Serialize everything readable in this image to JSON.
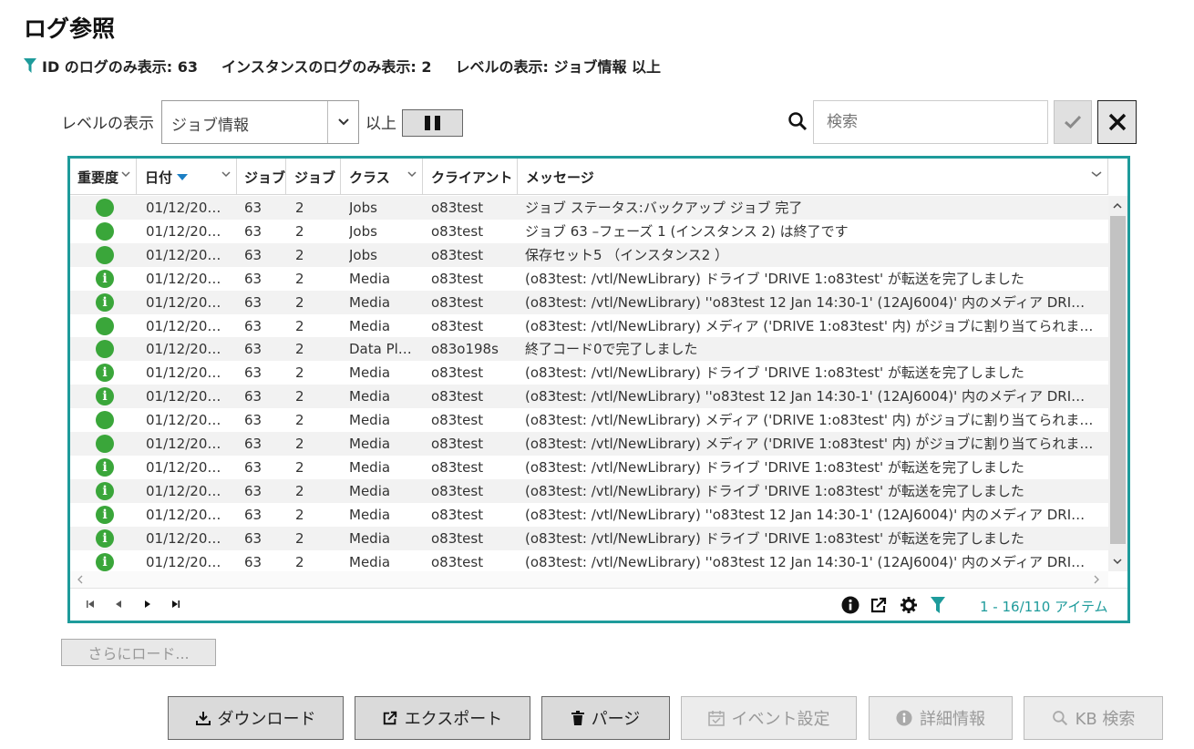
{
  "page": {
    "title": "ログ参照",
    "filter_summary": {
      "id_filter": "ID のログのみ表示: 63",
      "instance_filter": "インスタンスのログのみ表示: 2",
      "level_filter": "レベルの表示: ジョブ情報 以上"
    }
  },
  "toolbar": {
    "level_label": "レベルの表示",
    "level_value": "ジョブ情報",
    "above_label": "以上",
    "search_placeholder": "検索"
  },
  "table": {
    "columns": [
      "重要度",
      "日付",
      "ジョブ",
      "ジョブ",
      "クラス",
      "クライアント",
      "メッセージ"
    ],
    "rows": [
      {
        "sev": "ok",
        "date": "01/12/20…",
        "job": "63",
        "inst": "2",
        "class": "Jobs",
        "client": "o83test",
        "msg": "ジョブ ステータス:バックアップ ジョブ 完了"
      },
      {
        "sev": "ok",
        "date": "01/12/20…",
        "job": "63",
        "inst": "2",
        "class": "Jobs",
        "client": "o83test",
        "msg": "ジョブ 63 –フェーズ 1 (インスタンス 2) は終了です"
      },
      {
        "sev": "ok",
        "date": "01/12/20…",
        "job": "63",
        "inst": "2",
        "class": "Jobs",
        "client": "o83test",
        "msg": "保存セット5 （インスタンス2 ）"
      },
      {
        "sev": "info",
        "date": "01/12/20…",
        "job": "63",
        "inst": "2",
        "class": "Media",
        "client": "o83test",
        "msg": "(o83test: /vtl/NewLibrary) ドライブ 'DRIVE 1:o83test' が転送を完了しました"
      },
      {
        "sev": "info",
        "date": "01/12/20…",
        "job": "63",
        "inst": "2",
        "class": "Media",
        "client": "o83test",
        "msg": "(o83test: /vtl/NewLibrary) ''o83test 12 Jan 14:30-1' (12AJ6004)' 内のメディア DRI…"
      },
      {
        "sev": "ok",
        "date": "01/12/20…",
        "job": "63",
        "inst": "2",
        "class": "Media",
        "client": "o83test",
        "msg": "(o83test: /vtl/NewLibrary) メディア ('DRIVE 1:o83test' 内) がジョブに割り当てられま…"
      },
      {
        "sev": "ok",
        "date": "01/12/20…",
        "job": "63",
        "inst": "2",
        "class": "Data Pl…",
        "client": "o83o198s",
        "msg": "終了コード0で完了しました"
      },
      {
        "sev": "info",
        "date": "01/12/20…",
        "job": "63",
        "inst": "2",
        "class": "Media",
        "client": "o83test",
        "msg": "(o83test: /vtl/NewLibrary) ドライブ 'DRIVE 1:o83test' が転送を完了しました"
      },
      {
        "sev": "info",
        "date": "01/12/20…",
        "job": "63",
        "inst": "2",
        "class": "Media",
        "client": "o83test",
        "msg": "(o83test: /vtl/NewLibrary) ''o83test 12 Jan 14:30-1' (12AJ6004)' 内のメディア DRI…"
      },
      {
        "sev": "ok",
        "date": "01/12/20…",
        "job": "63",
        "inst": "2",
        "class": "Media",
        "client": "o83test",
        "msg": "(o83test: /vtl/NewLibrary) メディア ('DRIVE 1:o83test' 内) がジョブに割り当てられま…"
      },
      {
        "sev": "ok",
        "date": "01/12/20…",
        "job": "63",
        "inst": "2",
        "class": "Media",
        "client": "o83test",
        "msg": "(o83test: /vtl/NewLibrary) メディア ('DRIVE 1:o83test' 内) がジョブに割り当てられま…"
      },
      {
        "sev": "info",
        "date": "01/12/20…",
        "job": "63",
        "inst": "2",
        "class": "Media",
        "client": "o83test",
        "msg": "(o83test: /vtl/NewLibrary) ドライブ 'DRIVE 1:o83test' が転送を完了しました"
      },
      {
        "sev": "info",
        "date": "01/12/20…",
        "job": "63",
        "inst": "2",
        "class": "Media",
        "client": "o83test",
        "msg": "(o83test: /vtl/NewLibrary) ドライブ 'DRIVE 1:o83test' が転送を完了しました"
      },
      {
        "sev": "info",
        "date": "01/12/20…",
        "job": "63",
        "inst": "2",
        "class": "Media",
        "client": "o83test",
        "msg": "(o83test: /vtl/NewLibrary) ''o83test 12 Jan 14:30-1' (12AJ6004)' 内のメディア DRI…"
      },
      {
        "sev": "info",
        "date": "01/12/20…",
        "job": "63",
        "inst": "2",
        "class": "Media",
        "client": "o83test",
        "msg": "(o83test: /vtl/NewLibrary) ドライブ 'DRIVE 1:o83test' が転送を完了しました"
      },
      {
        "sev": "info",
        "date": "01/12/20…",
        "job": "63",
        "inst": "2",
        "class": "Media",
        "client": "o83test",
        "msg": "(o83test: /vtl/NewLibrary) ''o83test 12 Jan 14:30-1' (12AJ6004)' 内のメディア DRI…"
      }
    ],
    "item_count": "1 - 16/110 アイテム"
  },
  "buttons": {
    "load_more": "さらにロード...",
    "download": "ダウンロード",
    "export": "エクスポート",
    "purge": "パージ",
    "event_settings": "イベント設定",
    "details": "詳細情報",
    "kb_search": "KB 検索"
  },
  "colors": {
    "accent": "#1e9b9b",
    "severity_ok": "#3aa63a",
    "sort_arrow": "#1b7fc4"
  },
  "icons": {
    "severity_info_glyph": "i"
  }
}
